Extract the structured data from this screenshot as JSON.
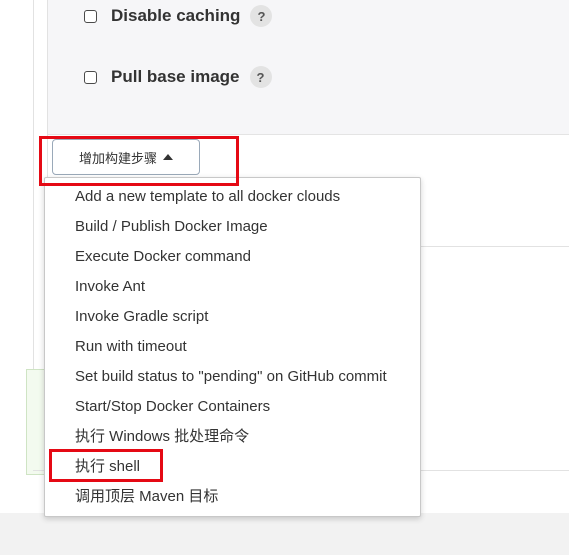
{
  "options": [
    {
      "label": "Disable caching",
      "help": "?"
    },
    {
      "label": "Pull base image",
      "help": "?"
    }
  ],
  "add_step_button": {
    "label": "增加构建步骤"
  },
  "menu": {
    "items": [
      "Add a new template to all docker clouds",
      "Build / Publish Docker Image",
      "Execute Docker command",
      "Invoke Ant",
      "Invoke Gradle script",
      "Run with timeout",
      "Set build status to \"pending\" on GitHub commit",
      "Start/Stop Docker Containers",
      "执行 Windows 批处理命令",
      "执行 shell",
      "调用顶层 Maven 目标"
    ]
  },
  "colors": {
    "highlight": "#e50914",
    "panel": "#f6f6f8",
    "text": "#333333"
  }
}
